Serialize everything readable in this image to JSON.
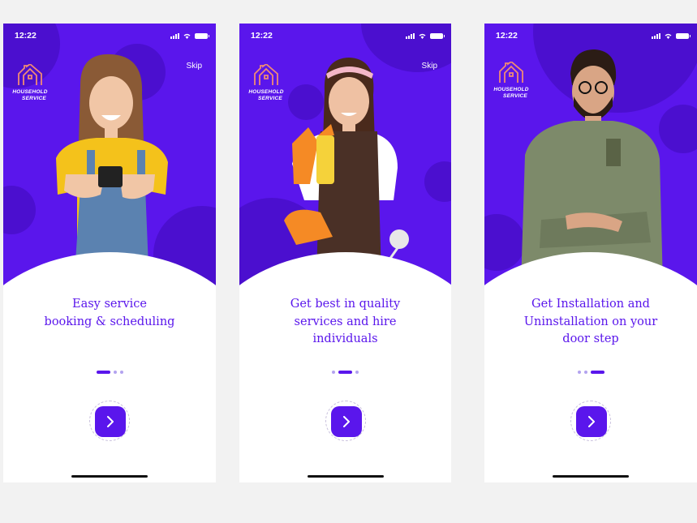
{
  "colors": {
    "brand": "#5a16ec",
    "brand_dark": "#4b0fcf",
    "background": "#f2f2f2"
  },
  "screens": [
    {
      "time": "12:22",
      "skip": "Skip",
      "logo": {
        "line1": "HOUSEHOLD",
        "line2": "SERVICE"
      },
      "caption_lines": [
        "Easy service",
        "booking & scheduling"
      ],
      "active_dot": 1,
      "dot_count": 3,
      "next_icon": "chevron-right-icon",
      "photo": "woman-with-phone"
    },
    {
      "time": "12:22",
      "skip": "Skip",
      "logo": {
        "line1": "HOUSEHOLD",
        "line2": "SERVICE"
      },
      "caption_lines": [
        "Get best in quality",
        "services and hire",
        "individuals"
      ],
      "active_dot": 2,
      "dot_count": 3,
      "next_icon": "chevron-right-icon",
      "photo": "cleaner-with-spray"
    },
    {
      "time": "12:22",
      "skip": "",
      "logo": {
        "line1": "HOUSEHOLD",
        "line2": "SERVICE"
      },
      "caption_lines": [
        "Get Installation and",
        "Uninstallation on your",
        "door step"
      ],
      "active_dot": 3,
      "dot_count": 3,
      "next_icon": "chevron-right-icon",
      "photo": "technician-arms-crossed"
    }
  ]
}
